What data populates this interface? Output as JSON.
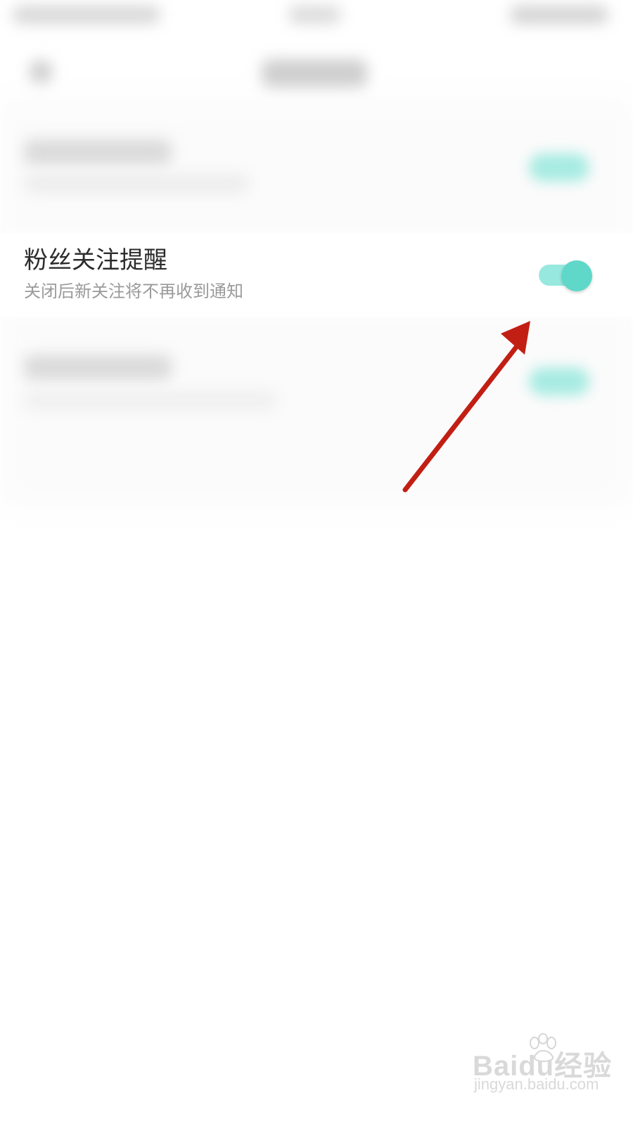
{
  "setting": {
    "title": "粉丝关注提醒",
    "subtitle": "关闭后新关注将不再收到通知",
    "enabled": true
  },
  "colors": {
    "toggle_track": "#97e8df",
    "toggle_knob": "#5fd8c9",
    "arrow": "#c21f14",
    "title_text": "#2c2c2c",
    "subtitle_text": "#9a9a9a"
  },
  "watermark": {
    "brand_text": "Baidu经验",
    "url_text": "jingyan.baidu.com"
  }
}
